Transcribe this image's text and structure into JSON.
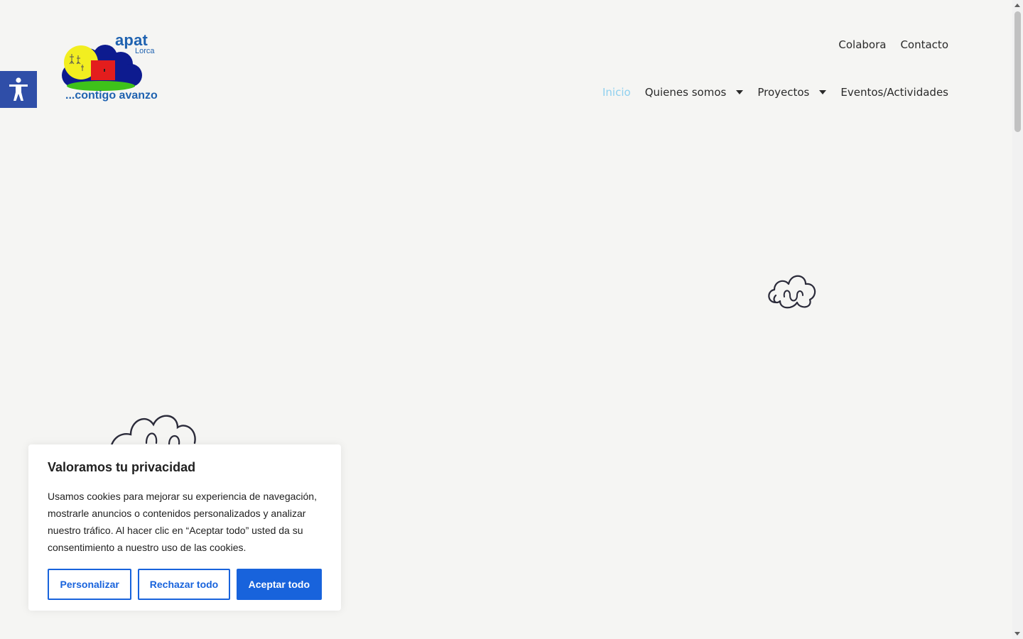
{
  "logo": {
    "name": "apat",
    "sub": "Lorca",
    "tagline": "...contigo avanzo"
  },
  "top_nav": [
    "Colabora",
    "Contacto"
  ],
  "main_nav": {
    "inicio": "Inicio",
    "quienes": "Quienes somos",
    "proyectos": "Proyectos",
    "eventos": "Eventos/Actividades"
  },
  "accessibility": {
    "icon": "accessibility-icon"
  },
  "cookie": {
    "title": "Valoramos tu privacidad",
    "text": "Usamos cookies para mejorar su experiencia de navegación, mostrarle anuncios o contenidos personalizados y analizar nuestro tráfico. Al hacer clic en “Aceptar todo” usted da su consentimiento a nuestro uso de las cookies.",
    "customize": "Personalizar",
    "reject": "Rechazar todo",
    "accept": "Aceptar todo"
  },
  "colors": {
    "brand_blue": "#1f62b0",
    "active_link": "#8fd0ef",
    "cookie_button": "#1863dc",
    "a11y_bg": "#2f4ea8"
  }
}
